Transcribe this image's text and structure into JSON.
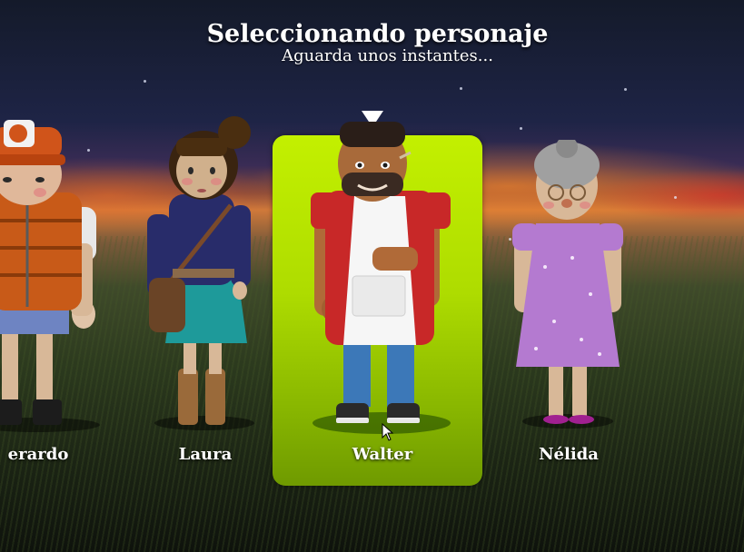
{
  "header": {
    "title": "Seleccionando personaje",
    "subtitle": "Aguarda unos instantes..."
  },
  "characters": [
    {
      "name": "erardo",
      "selected": false
    },
    {
      "name": "Laura",
      "selected": false
    },
    {
      "name": "Walter",
      "selected": true
    },
    {
      "name": "Nélida",
      "selected": false
    }
  ],
  "colors": {
    "selection_card": "#b7e600",
    "text": "#ffffff"
  }
}
